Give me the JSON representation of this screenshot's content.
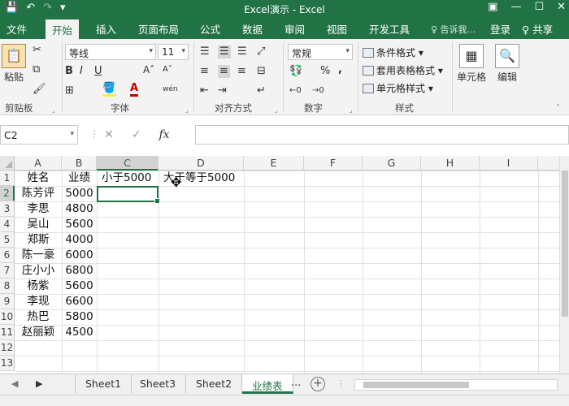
{
  "window": {
    "title": "Excel演示 - Excel",
    "win_buttons": [
      "▣",
      "—",
      "☐",
      "✕"
    ]
  },
  "quick_access": [
    "💾",
    "↶",
    "↷",
    "▾"
  ],
  "ribbon_tabs": [
    {
      "label": "文件"
    },
    {
      "label": "开始"
    },
    {
      "label": "插入"
    },
    {
      "label": "页面布局"
    },
    {
      "label": "公式"
    },
    {
      "label": "数据"
    },
    {
      "label": "审阅"
    },
    {
      "label": "视图"
    },
    {
      "label": "开发工具"
    }
  ],
  "tell_me": "♀ 告诉我...",
  "login": "登录",
  "share": "♀ 共享",
  "clipboard": {
    "paste_label": "粘贴",
    "group": "剪贴板"
  },
  "font": {
    "family": "等线",
    "size": "11",
    "group": "字体",
    "grow": "A˄",
    "shrink": "A˅",
    "bold": "B",
    "italic": "I",
    "underline": "U",
    "phonetic": "wén"
  },
  "alignment": {
    "group": "对齐方式"
  },
  "number": {
    "format": "常规",
    "group": "数字",
    "percent": "%",
    "comma": ","
  },
  "styles": {
    "items": [
      "条件格式",
      "套用表格格式",
      "单元格样式"
    ],
    "group": "样式"
  },
  "cells_btn": {
    "label": "单元格"
  },
  "edit_btn": {
    "label": "编辑"
  },
  "formula_bar": {
    "name_box": "C2",
    "cancel": "✕",
    "enter": "✓",
    "fx": "fx",
    "value": ""
  },
  "columns": [
    "A",
    "B",
    "C",
    "D",
    "E",
    "F",
    "G",
    "H",
    "I"
  ],
  "rows": [
    "1",
    "2",
    "3",
    "4",
    "5",
    "6",
    "7",
    "8",
    "9",
    "10",
    "11",
    "12",
    "13"
  ],
  "headers": {
    "name": "姓名",
    "score": "业绩",
    "lt": "小于5000",
    "ge": "大于等于5000"
  },
  "table": [
    {
      "name": "陈芳评",
      "score": "5000"
    },
    {
      "name": "李思",
      "score": "4800"
    },
    {
      "name": "吴山",
      "score": "5600"
    },
    {
      "name": "郑斯",
      "score": "4000"
    },
    {
      "name": "陈一豪",
      "score": "6000"
    },
    {
      "name": "庄小小",
      "score": "6800"
    },
    {
      "name": "杨紫",
      "score": "5600"
    },
    {
      "name": "李现",
      "score": "6600"
    },
    {
      "name": "热巴",
      "score": "5800"
    },
    {
      "name": "赵丽颖",
      "score": "4500"
    }
  ],
  "sheets": [
    {
      "label": "Sheet1"
    },
    {
      "label": "Sheet3"
    },
    {
      "label": "Sheet2"
    },
    {
      "label": "业绩表"
    }
  ],
  "more_sheets": "...",
  "add_sheet": "+",
  "colors": {
    "accent": "#217346",
    "ribbon": "#f3f3f3"
  }
}
